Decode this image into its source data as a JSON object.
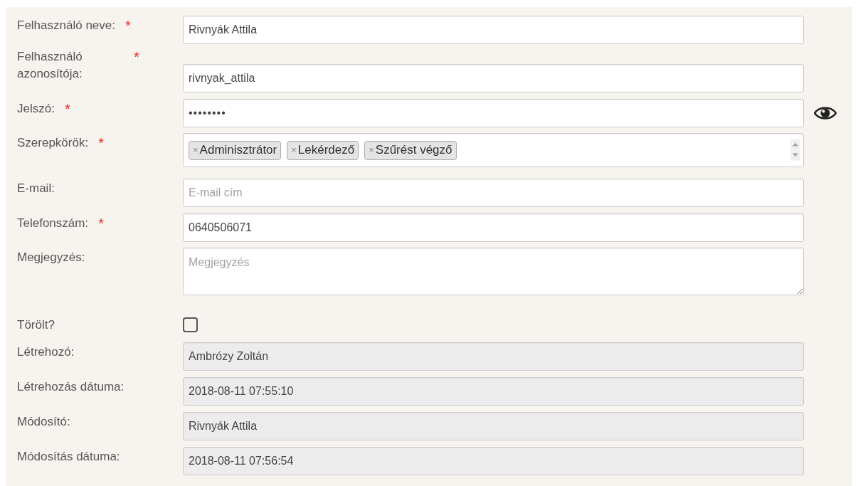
{
  "fields": [
    {
      "kind": "text",
      "label": "Felhasználó neve:",
      "marker": "*",
      "value": "Rivnyák Attila"
    },
    {
      "kind": "text",
      "label": "Felhasználó azonosítója:",
      "marker": "*",
      "value": "rivnyak_attila"
    },
    {
      "kind": "password",
      "label": "Jelszó:",
      "marker": "*",
      "value": "••••••••"
    },
    {
      "kind": "tags",
      "label": "Szerepkörök:",
      "marker": "*",
      "tags": [
        "Adminisztrátor",
        "Lekérdező",
        "Szűrést végző"
      ],
      "remove": "×"
    },
    {
      "kind": "text",
      "label": "E-mail:",
      "placeholder": "E-mail cím"
    },
    {
      "kind": "text",
      "label": "Telefonszám:",
      "marker": "*",
      "value": "0640506071"
    },
    {
      "kind": "textarea",
      "label": "Megjegyzés:",
      "placeholder": "Megjegyzés"
    },
    {
      "kind": "checkbox",
      "label": "Törölt?",
      "checked": false
    },
    {
      "kind": "readonly",
      "label": "Létrehozó:",
      "value": "Ambrózy Zoltán"
    },
    {
      "kind": "readonly",
      "label": "Létrehozás dátuma:",
      "value": "2018-08-11 07:55:10"
    },
    {
      "kind": "readonly",
      "label": "Módosító:",
      "value": "Rivnyák Attila"
    },
    {
      "kind": "readonly",
      "label": "Módosítás dátuma:",
      "value": "2018-08-11 07:56:54"
    }
  ]
}
